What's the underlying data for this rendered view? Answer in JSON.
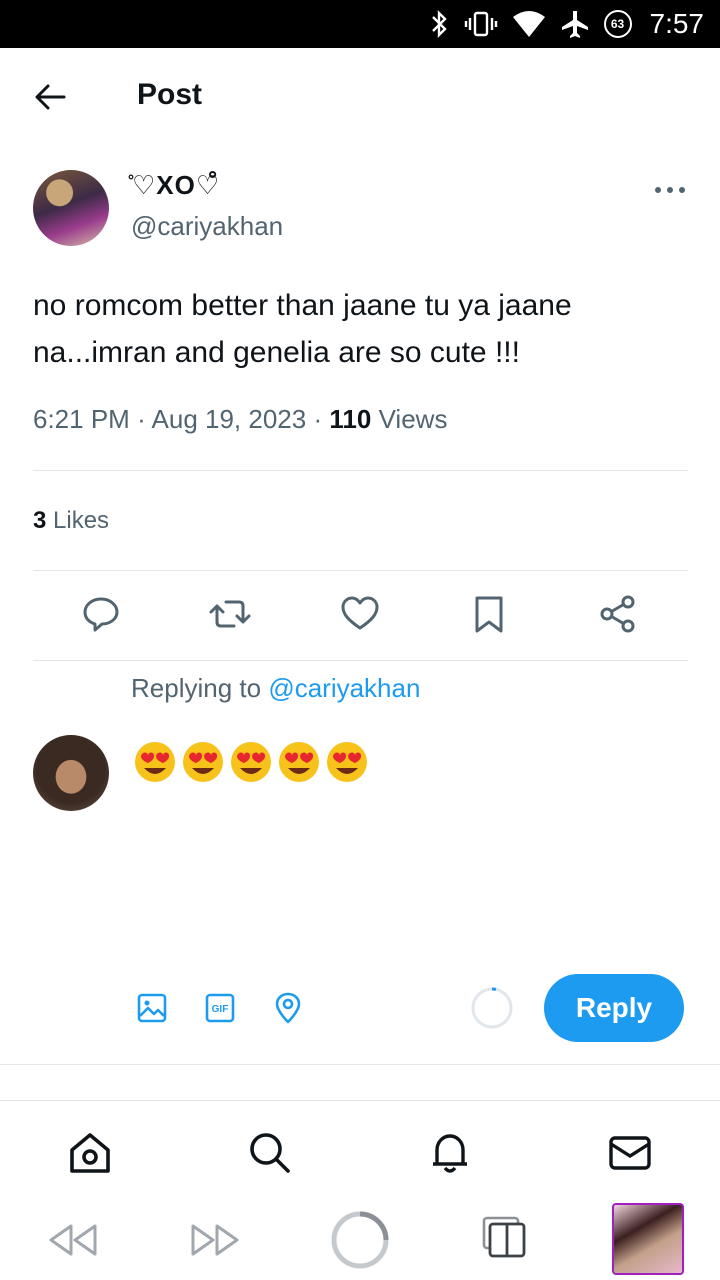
{
  "status_bar": {
    "time": "7:57",
    "battery_level": "63",
    "icons": [
      "bluetooth-icon",
      "vibrate-icon",
      "wifi-icon",
      "airplane-mode-icon",
      "battery-saver-icon"
    ]
  },
  "header": {
    "back_icon": "arrow-left-icon",
    "title": "Post"
  },
  "post": {
    "display_name": "̥̥̥̥̥̥̥̥ ̥̥̥̥̥ ♡ XO ♡ ̥̥̥̥̥",
    "display_name_shown": "̊♡XO♡̊",
    "handle": "@cariyakhan",
    "text": "no romcom better than jaane tu ya jaane na...imran and genelia are so cute !!!",
    "time": "6:21 PM",
    "date": "Aug 19, 2023",
    "views_count": "110",
    "views_label": "Views",
    "likes_count": "3",
    "likes_label": "Likes",
    "separator": "·"
  },
  "actions": [
    "reply-icon",
    "retweet-icon",
    "like-icon",
    "bookmark-icon",
    "share-icon"
  ],
  "reply_composer": {
    "replying_to_label": "Replying to",
    "replying_to_handle": "@cariyakhan",
    "draft_text": "😍😍😍😍😍",
    "tools": [
      "image-icon",
      "gif-icon",
      "location-icon"
    ],
    "reply_button_label": "Reply",
    "gif_label": "GIF"
  },
  "bottom_nav": [
    "home-icon",
    "search-icon",
    "notifications-icon",
    "messages-icon"
  ],
  "system_nav": [
    "rewind-icon",
    "fast-forward-icon",
    "home-circle-icon",
    "tabs-icon",
    "recent-app-thumbnail"
  ],
  "colors": {
    "accent": "#1d9bf0",
    "text_primary": "#0f1419",
    "text_secondary": "#536471",
    "divider": "#e1e6ea"
  }
}
